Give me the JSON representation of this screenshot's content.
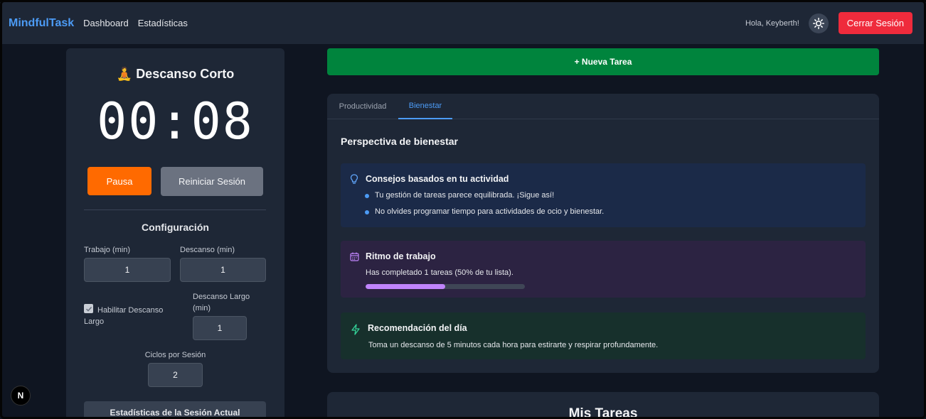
{
  "navbar": {
    "brand": "MindfulTask",
    "links": [
      "Dashboard",
      "Estadísticas"
    ],
    "greeting": "Hola, Keyberth!",
    "theme_icon": "sun-icon",
    "logout_label": "Cerrar Sesión"
  },
  "timer_panel": {
    "mode_icon": "🧘",
    "mode_title": "Descanso Corto",
    "time": "00:08",
    "pause_label": "Pausa",
    "reset_label": "Reiniciar Sesión",
    "config_title": "Configuración",
    "work_label": "Trabajo (min)",
    "work_value": "1",
    "break_label": "Descanso (min)",
    "break_value": "1",
    "long_break_enable_label": "Habilitar Descanso Largo",
    "long_break_enabled": true,
    "long_break_label": "Descanso Largo (min)",
    "long_break_value": "1",
    "cycles_label": "Ciclos por Sesión",
    "cycles_value": "2",
    "stats_label": "Estadísticas de la Sesión Actual"
  },
  "new_task_label": "+ Nueva Tarea",
  "insights": {
    "tabs": [
      {
        "label": "Productividad",
        "active": false
      },
      {
        "label": "Bienestar",
        "active": true
      }
    ],
    "title": "Perspectiva de bienestar",
    "tips": {
      "icon": "lightbulb-icon",
      "title": "Consejos basados en tu actividad",
      "items": [
        "Tu gestión de tareas parece equilibrada. ¡Sigue así!",
        "No olvides programar tiempo para actividades de ocio y bienestar."
      ]
    },
    "rhythm": {
      "icon": "calendar-icon",
      "title": "Ritmo de trabajo",
      "text": "Has completado 1 tareas (50% de tu lista).",
      "progress_percent": 50
    },
    "recommendation": {
      "icon": "lightning-icon",
      "title": "Recomendación del día",
      "text": "Toma un descanso de 5 minutos cada hora para estirarte y respirar profundamente."
    }
  },
  "tasks": {
    "title": "Mis Tareas"
  },
  "colors": {
    "accent_blue": "#4c9bf5",
    "pause_orange": "#ff6a00",
    "logout_red": "#ef2b3c",
    "new_task_green": "#00843d",
    "progress_purple": "#c084fc"
  }
}
